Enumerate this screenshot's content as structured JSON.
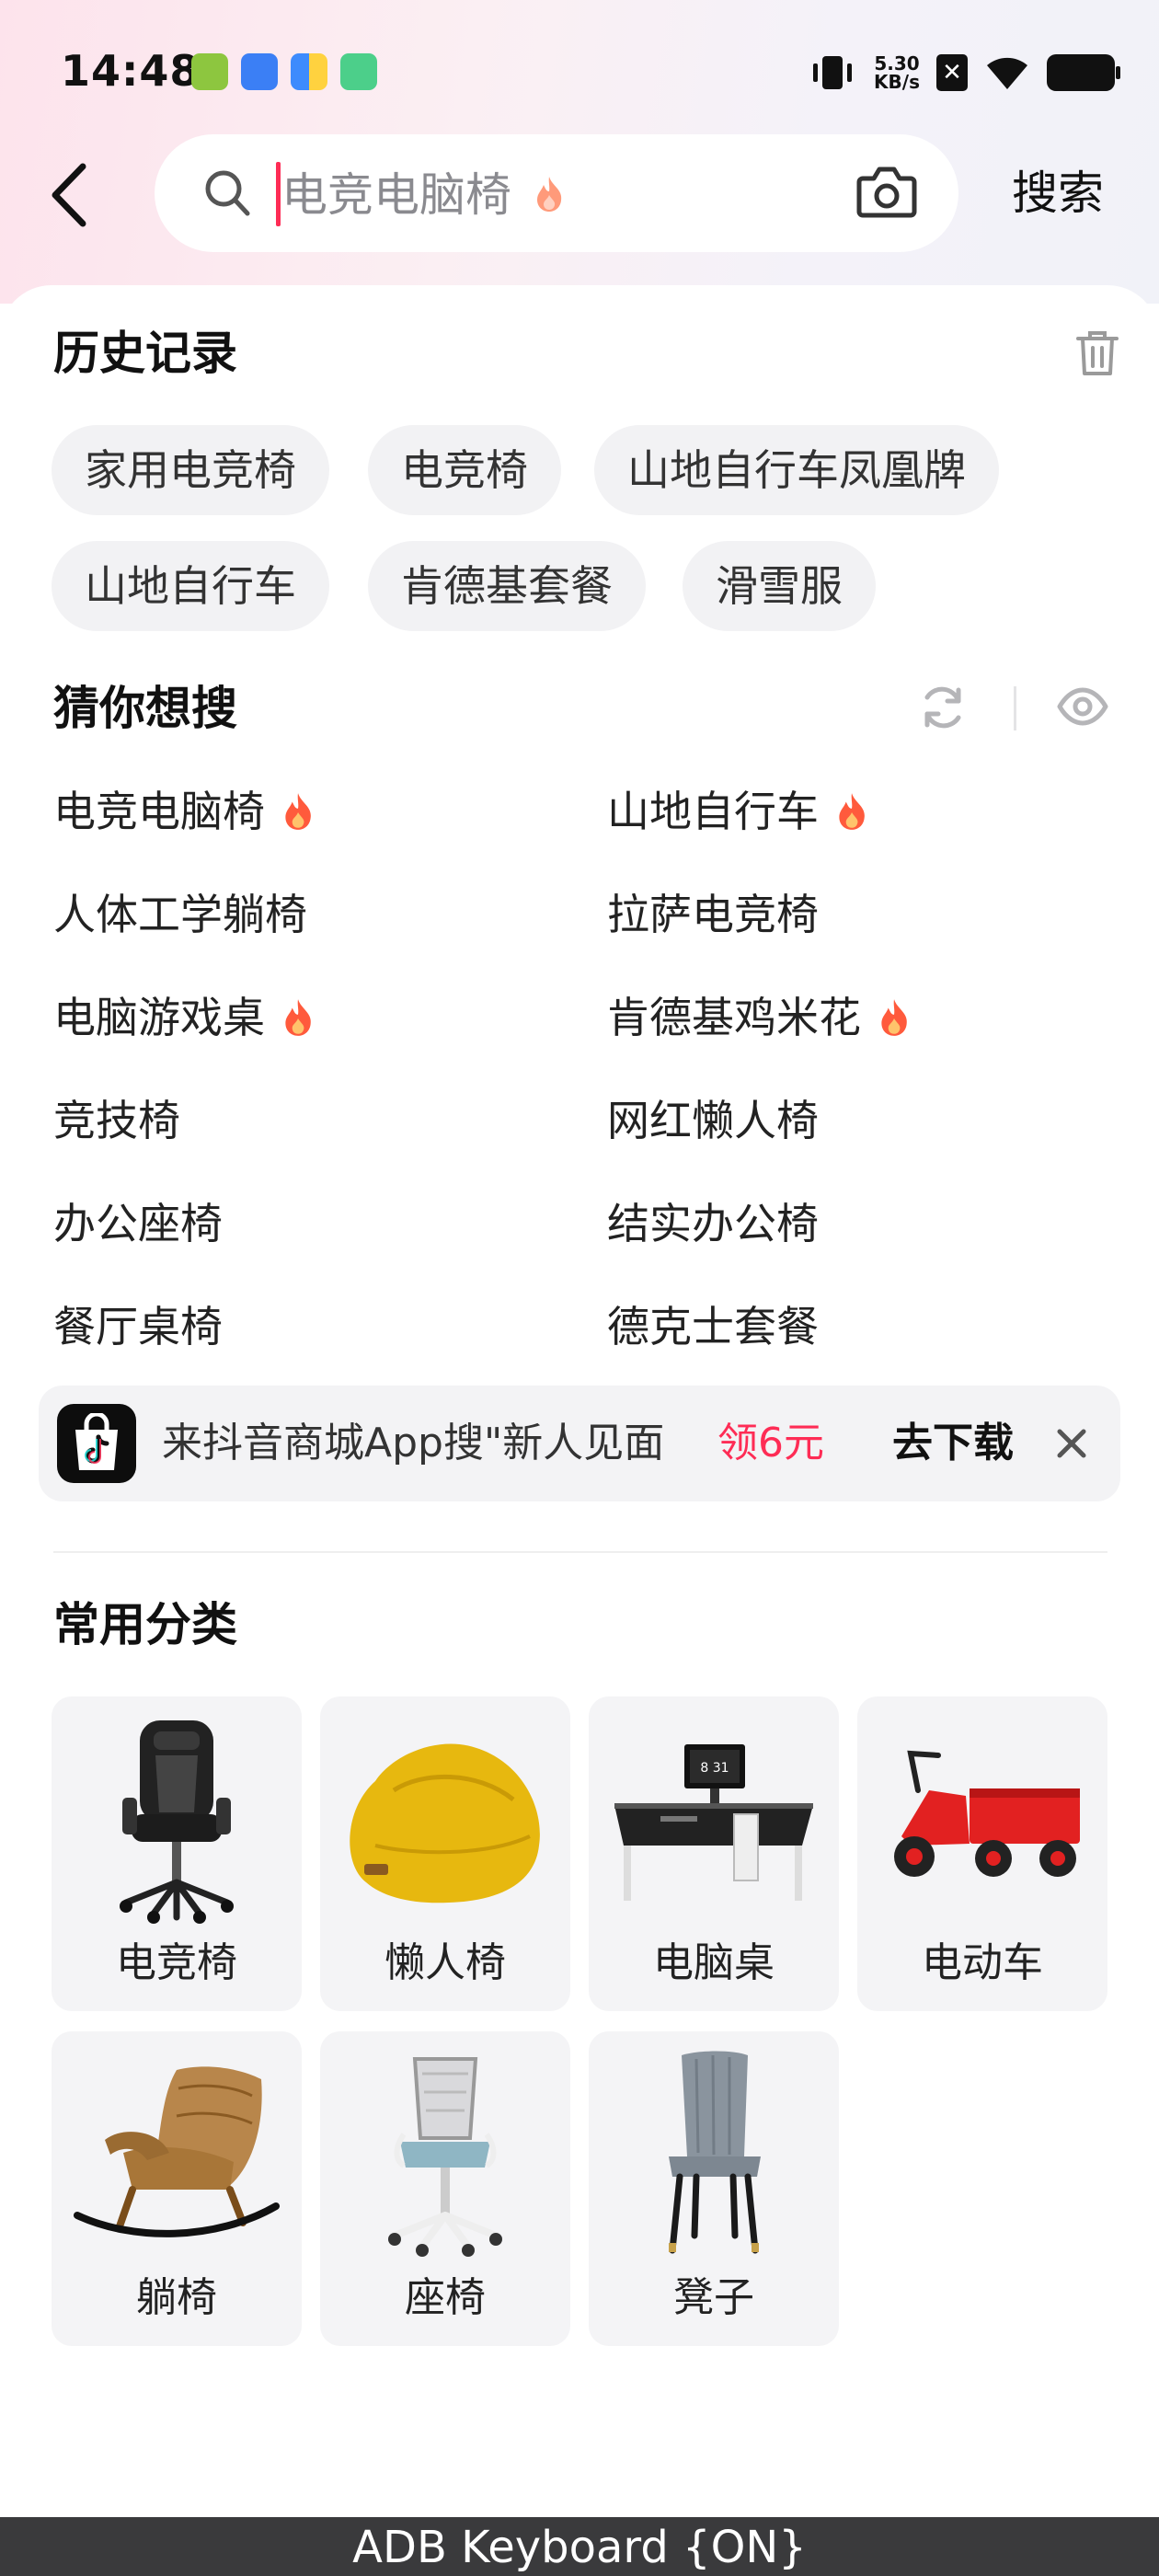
{
  "status_bar": {
    "time": "14:48",
    "net_speed_value": "5.30",
    "net_speed_unit": "KB/s"
  },
  "search": {
    "query": "电竞电脑椅",
    "submit_label": "搜索"
  },
  "history": {
    "title": "历史记录",
    "chips": [
      "家用电竞椅",
      "电竞椅",
      "山地自行车凤凰牌",
      "山地自行车",
      "肯德基套餐",
      "滑雪服"
    ]
  },
  "guess": {
    "title": "猜你想搜",
    "items": [
      {
        "label": "电竞电脑椅",
        "hot": true
      },
      {
        "label": "山地自行车",
        "hot": true
      },
      {
        "label": "人体工学躺椅",
        "hot": false
      },
      {
        "label": "拉萨电竞椅",
        "hot": false
      },
      {
        "label": "电脑游戏桌",
        "hot": true
      },
      {
        "label": "肯德基鸡米花",
        "hot": true
      },
      {
        "label": "竞技椅",
        "hot": false
      },
      {
        "label": "网红懒人椅",
        "hot": false
      },
      {
        "label": "办公座椅",
        "hot": false
      },
      {
        "label": "结实办公椅",
        "hot": false
      },
      {
        "label": "餐厅桌椅",
        "hot": false
      },
      {
        "label": "德克士套餐",
        "hot": false
      }
    ]
  },
  "banner": {
    "text": "来抖音商城App搜\"新人见面",
    "reward": "领6元",
    "action": "去下载"
  },
  "categories": {
    "title": "常用分类",
    "items": [
      {
        "label": "电竞椅",
        "icon": "gaming-chair-image"
      },
      {
        "label": "懒人椅",
        "icon": "bean-bag-image"
      },
      {
        "label": "电脑桌",
        "icon": "computer-desk-image"
      },
      {
        "label": "电动车",
        "icon": "electric-tricycle-image"
      },
      {
        "label": "躺椅",
        "icon": "rocking-chair-image"
      },
      {
        "label": "座椅",
        "icon": "office-chair-image"
      },
      {
        "label": "凳子",
        "icon": "dining-chair-image"
      }
    ]
  },
  "keyboard": {
    "status": "ADB Keyboard {ON}"
  },
  "colors": {
    "accent": "#fe2c55",
    "hot_icon": "#ff5a3c"
  }
}
